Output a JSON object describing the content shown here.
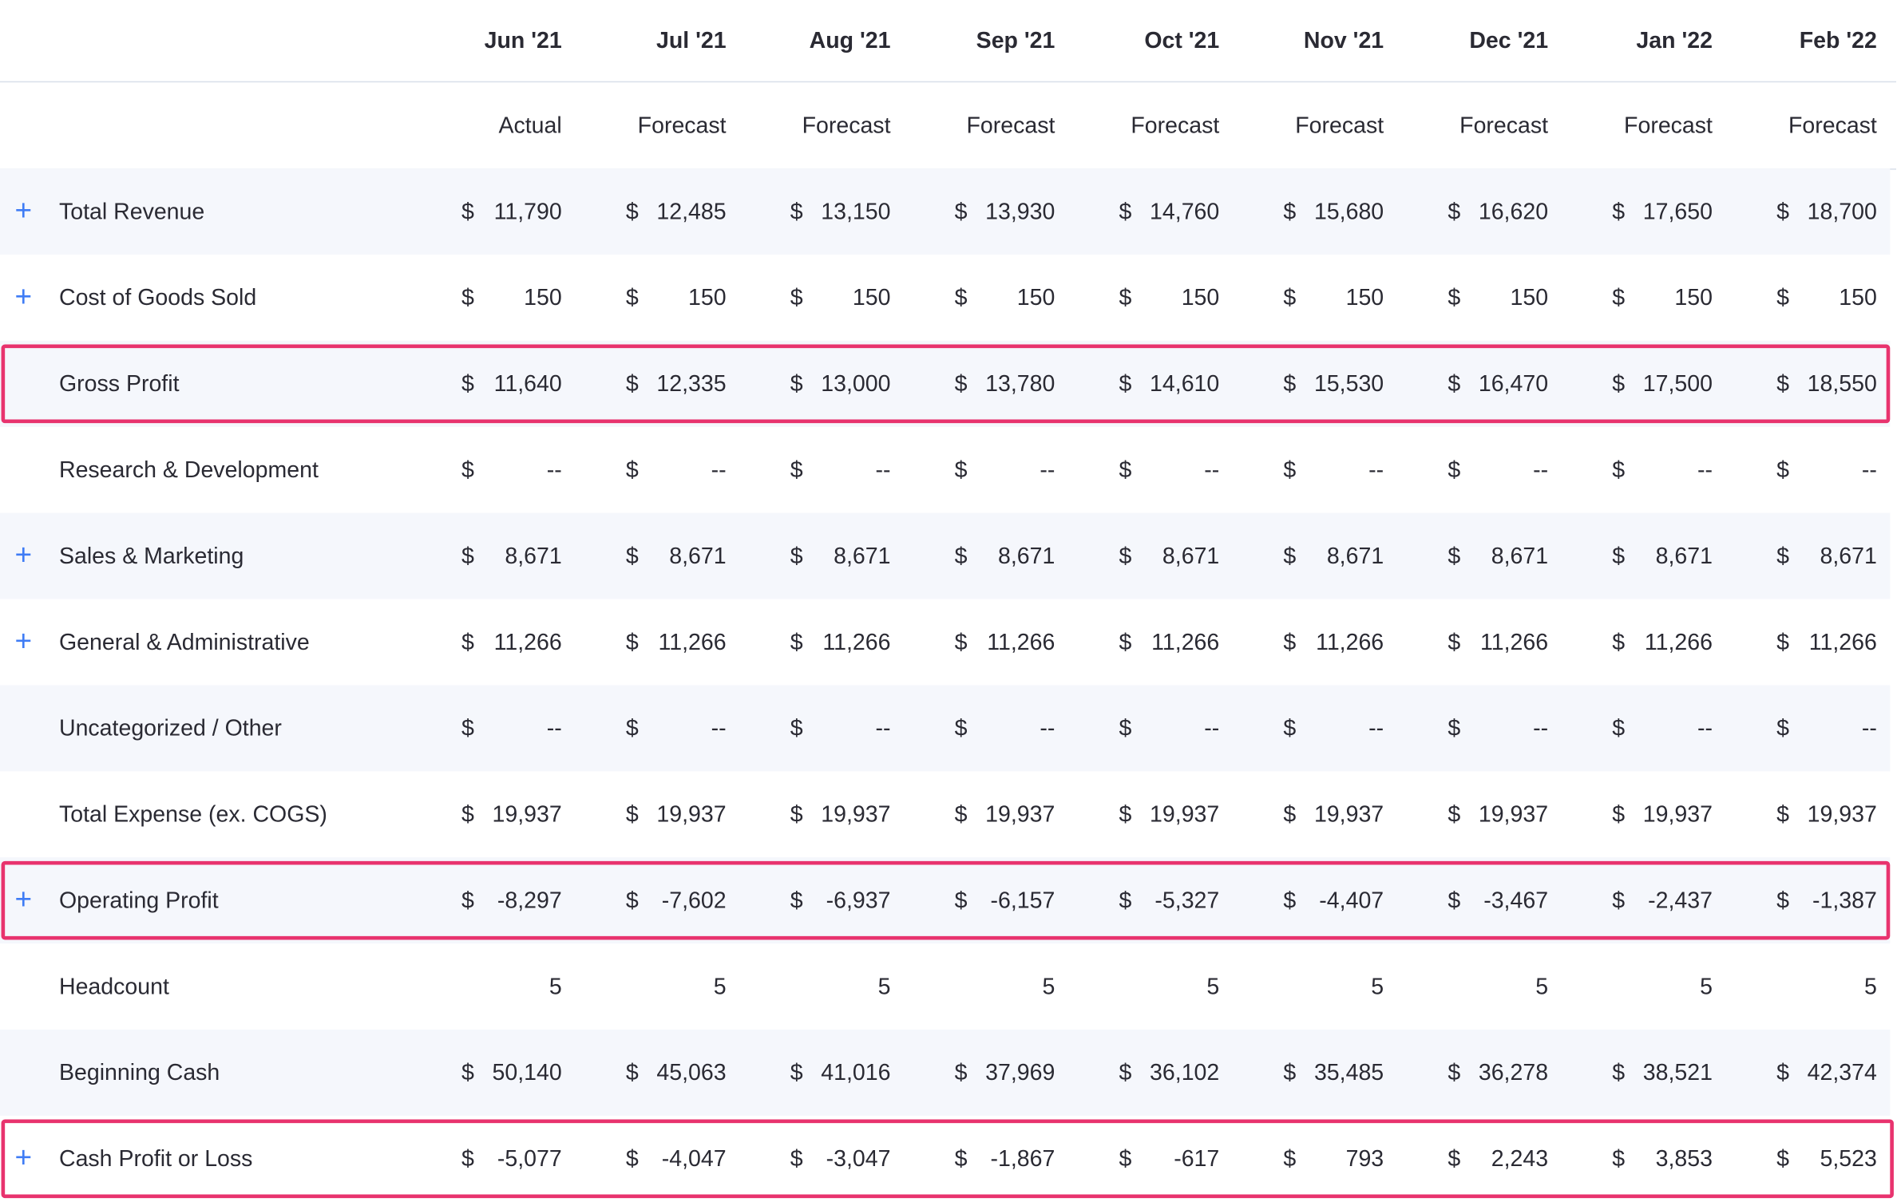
{
  "header": {
    "months": [
      "Jun '21",
      "Jul '21",
      "Aug '21",
      "Sep '21",
      "Oct '21",
      "Nov '21",
      "Dec '21",
      "Jan '22",
      "Feb '22"
    ],
    "types": [
      "Actual",
      "Forecast",
      "Forecast",
      "Forecast",
      "Forecast",
      "Forecast",
      "Forecast",
      "Forecast",
      "Forecast"
    ]
  },
  "icons": {
    "expand": "plus-icon"
  },
  "colors": {
    "expand_icon": "#3f7cf5",
    "highlight_border": "#e8336e",
    "row_shade": "#f5f7fc"
  },
  "expand_symbol": "+",
  "currency": "$",
  "rows": [
    {
      "label": "Total Revenue",
      "expandable": true,
      "currency": true,
      "highlighted": false,
      "values": [
        "11,790",
        "12,485",
        "13,150",
        "13,930",
        "14,760",
        "15,680",
        "16,620",
        "17,650",
        "18,700"
      ]
    },
    {
      "label": "Cost of Goods Sold",
      "expandable": true,
      "currency": true,
      "highlighted": false,
      "values": [
        "150",
        "150",
        "150",
        "150",
        "150",
        "150",
        "150",
        "150",
        "150"
      ]
    },
    {
      "label": "Gross Profit",
      "expandable": false,
      "currency": true,
      "highlighted": true,
      "values": [
        "11,640",
        "12,335",
        "13,000",
        "13,780",
        "14,610",
        "15,530",
        "16,470",
        "17,500",
        "18,550"
      ]
    },
    {
      "label": "Research & Development",
      "expandable": false,
      "currency": true,
      "highlighted": false,
      "values": [
        "--",
        "--",
        "--",
        "--",
        "--",
        "--",
        "--",
        "--",
        "--"
      ]
    },
    {
      "label": "Sales & Marketing",
      "expandable": true,
      "currency": true,
      "highlighted": false,
      "values": [
        "8,671",
        "8,671",
        "8,671",
        "8,671",
        "8,671",
        "8,671",
        "8,671",
        "8,671",
        "8,671"
      ]
    },
    {
      "label": "General & Administrative",
      "expandable": true,
      "currency": true,
      "highlighted": false,
      "values": [
        "11,266",
        "11,266",
        "11,266",
        "11,266",
        "11,266",
        "11,266",
        "11,266",
        "11,266",
        "11,266"
      ]
    },
    {
      "label": "Uncategorized / Other",
      "expandable": false,
      "currency": true,
      "highlighted": false,
      "values": [
        "--",
        "--",
        "--",
        "--",
        "--",
        "--",
        "--",
        "--",
        "--"
      ]
    },
    {
      "label": "Total Expense (ex. COGS)",
      "expandable": false,
      "currency": true,
      "highlighted": false,
      "values": [
        "19,937",
        "19,937",
        "19,937",
        "19,937",
        "19,937",
        "19,937",
        "19,937",
        "19,937",
        "19,937"
      ]
    },
    {
      "label": "Operating Profit",
      "expandable": true,
      "currency": true,
      "highlighted": true,
      "values": [
        "-8,297",
        "-7,602",
        "-6,937",
        "-6,157",
        "-5,327",
        "-4,407",
        "-3,467",
        "-2,437",
        "-1,387"
      ]
    },
    {
      "label": "Headcount",
      "expandable": false,
      "currency": false,
      "highlighted": false,
      "values": [
        "5",
        "5",
        "5",
        "5",
        "5",
        "5",
        "5",
        "5",
        "5"
      ]
    },
    {
      "label": "Beginning Cash",
      "expandable": false,
      "currency": true,
      "highlighted": false,
      "values": [
        "50,140",
        "45,063",
        "41,016",
        "37,969",
        "36,102",
        "35,485",
        "36,278",
        "38,521",
        "42,374"
      ]
    },
    {
      "label": "Cash Profit or Loss",
      "expandable": true,
      "currency": true,
      "highlighted": true,
      "values": [
        "-5,077",
        "-4,047",
        "-3,047",
        "-1,867",
        "-617",
        "793",
        "2,243",
        "3,853",
        "5,523"
      ]
    }
  ]
}
